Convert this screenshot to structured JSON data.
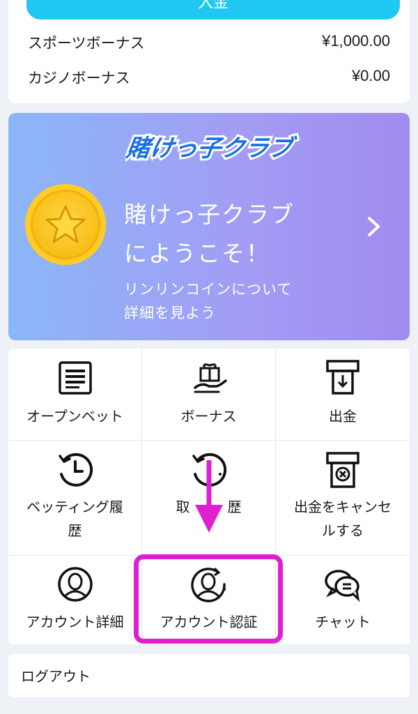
{
  "balance": {
    "deposit_label": "入金",
    "rows": [
      {
        "label": "スポーツボーナス",
        "amount": "¥1,000.00"
      },
      {
        "label": "カジノボーナス",
        "amount": "¥0.00"
      }
    ]
  },
  "banner": {
    "logo_text": "賭けっ子クラブ",
    "title_line1": "賭けっ子クラブ",
    "title_line2": "にようこそ！",
    "sub_line1": "リンリンコインについて",
    "sub_line2": "詳細を見よう"
  },
  "menu": {
    "items": [
      {
        "label": "オープンベット",
        "icon": "list-icon"
      },
      {
        "label": "ボーナス",
        "icon": "gift-icon"
      },
      {
        "label": "出金",
        "icon": "atm-withdraw-icon"
      },
      {
        "label_line1": "ベッティング履",
        "label_line2": "歴",
        "icon": "history-icon"
      },
      {
        "label_part1": "取",
        "label_part2": "歴",
        "icon": "history-icon"
      },
      {
        "label_line1": "出金をキャンセ",
        "label_line2": "ルする",
        "icon": "cancel-withdraw-icon"
      },
      {
        "label": "アカウント詳細",
        "icon": "user-icon"
      },
      {
        "label": "アカウント認証",
        "icon": "user-verify-icon"
      },
      {
        "label": "チャット",
        "icon": "chat-icon"
      }
    ]
  },
  "logout": {
    "label": "ログアウト"
  },
  "colors": {
    "accent": "#1fc8f2",
    "annotation": "#e01fd0",
    "coin": "#f7b911"
  }
}
